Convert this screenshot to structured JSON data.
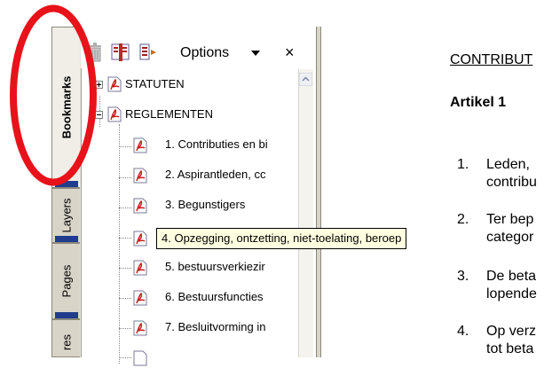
{
  "tabs": {
    "bookmarks": "Bookmarks",
    "layers": "Layers",
    "pages": "Pages",
    "more": "res"
  },
  "toolbar": {
    "options_label": "Options",
    "close_label": "×",
    "icons": [
      "trash-icon",
      "bookmark-icon",
      "new-bookmark-icon",
      "chevron-down-icon"
    ]
  },
  "tree": {
    "items": [
      {
        "label": "STATUTEN",
        "expander": "plus"
      },
      {
        "label": "REGLEMENTEN",
        "expander": "minus"
      },
      {
        "label": "1. Contributies en bi"
      },
      {
        "label": "2. Aspirantleden, cc"
      },
      {
        "label": "3. Begunstigers"
      },
      {
        "label": "4. Opzegging, ontzetting, niet-toelating, beroep"
      },
      {
        "label": "5. bestuursverkiezir"
      },
      {
        "label": "6. Bestuursfuncties"
      },
      {
        "label": "7. Besluitvorming in"
      }
    ]
  },
  "tooltip": "4. Opzegging, ontzetting, niet-toelating, beroep",
  "document": {
    "heading": "CONTRIBUT",
    "article": "Artikel 1",
    "items": [
      {
        "num": "1.",
        "line1": "Leden,",
        "line2": "contribu"
      },
      {
        "num": "2.",
        "line1": "Ter bep",
        "line2": "categor"
      },
      {
        "num": "3.",
        "line1": "De beta",
        "line2": "lopende"
      },
      {
        "num": "4.",
        "line1": "Op verz",
        "line2": "tot beta"
      }
    ]
  },
  "colors": {
    "highlight": "#e8121a",
    "tab_blue": "#1f3d8c",
    "tooltip_bg": "#ffffe1"
  }
}
